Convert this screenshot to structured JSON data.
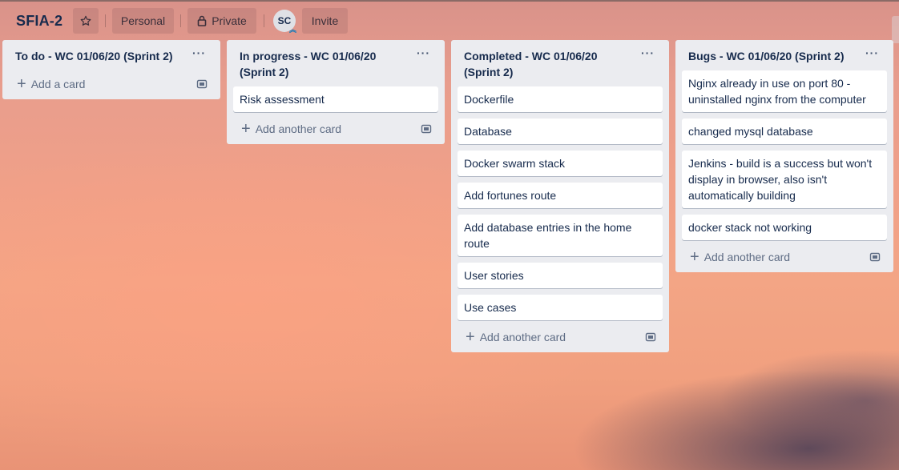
{
  "board": {
    "title": "SFIA-2",
    "personal_label": "Personal",
    "private_label": "Private",
    "avatar_initials": "SC",
    "invite_label": "Invite"
  },
  "lists": [
    {
      "title": "To do - WC 01/06/20 (Sprint 2)",
      "cards": [],
      "add_label": "Add a card"
    },
    {
      "title": "In progress - WC 01/06/20 (Sprint 2)",
      "cards": [
        "Risk assessment"
      ],
      "add_label": "Add another card"
    },
    {
      "title": "Completed - WC 01/06/20 (Sprint 2)",
      "cards": [
        "Dockerfile",
        "Database",
        "Docker swarm stack",
        "Add fortunes route",
        "Add database entries in the home route",
        "User stories",
        "Use cases"
      ],
      "add_label": "Add another card"
    },
    {
      "title": "Bugs - WC 01/06/20 (Sprint 2)",
      "cards": [
        "Nginx already in use on port 80 - uninstalled nginx from the computer",
        "changed mysql database",
        "Jenkins - build is a success but won't display in browser, also isn't automatically building",
        "docker stack not working"
      ],
      "add_label": "Add another card"
    }
  ],
  "icons": {
    "star": "star-icon",
    "lock": "lock-icon",
    "menu": "more-horizontal-icon",
    "plus": "plus-icon",
    "template": "card-template-icon"
  }
}
